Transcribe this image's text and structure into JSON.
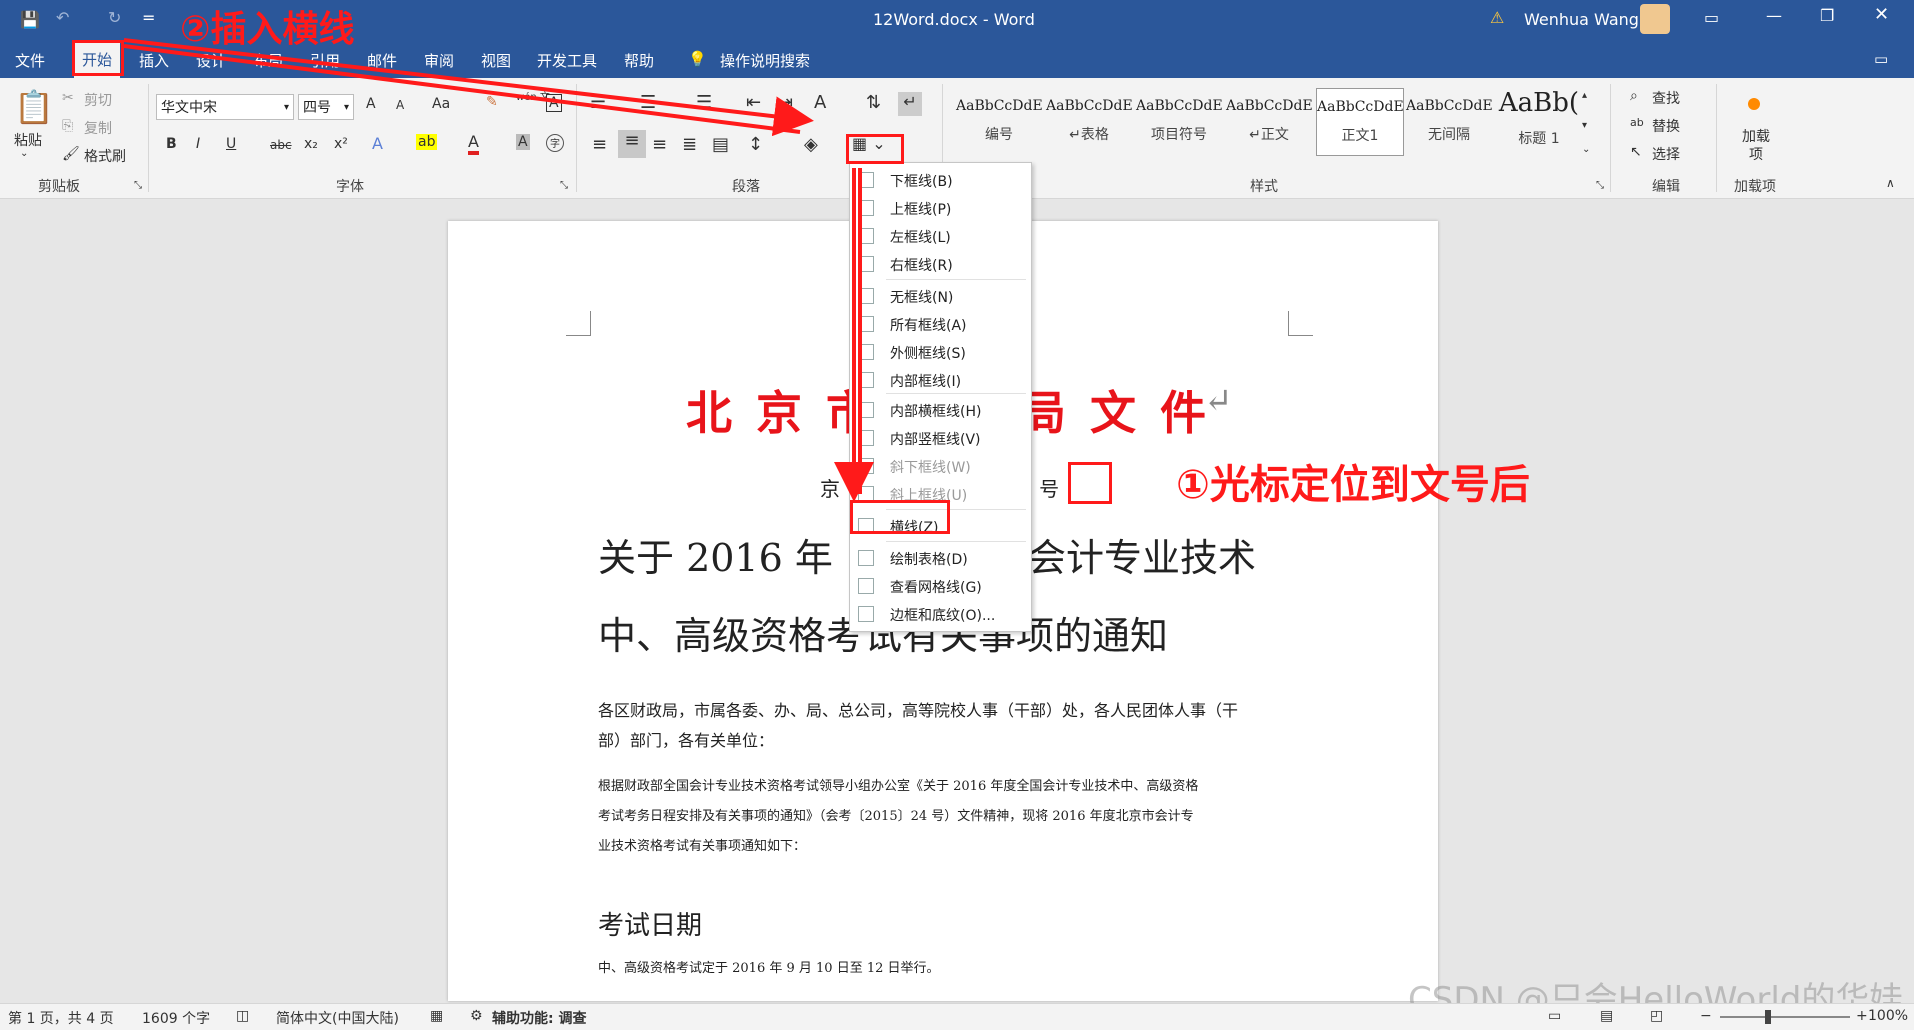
{
  "titlebar": {
    "doc_title": "12Word.docx  -  Word",
    "user_name": "Wenhua Wang",
    "qat_more": "="
  },
  "menu_tabs": [
    "文件",
    "开始",
    "插入",
    "设计",
    "布局",
    "引用",
    "邮件",
    "审阅",
    "视图",
    "开发工具",
    "帮助"
  ],
  "tell_me": "操作说明搜索",
  "clipboard": {
    "paste": "粘贴",
    "cut": "剪切",
    "copy": "复制",
    "format_painter": "格式刷",
    "group": "剪贴板"
  },
  "font": {
    "name": "华文中宋",
    "size": "四号",
    "change_case": "Aa",
    "group": "字体",
    "grow": "A",
    "shrink": "A",
    "bold": "B",
    "italic": "I",
    "underline": "U",
    "strike": "abc",
    "sub": "x₂",
    "sup": "x²",
    "font_color": "A",
    "phonetic": "wén 文",
    "border_char": "A",
    "clear": "A"
  },
  "paragraph": {
    "group": "段落"
  },
  "styles": {
    "group": "样式",
    "items": [
      {
        "preview": "AaBbCcDdE",
        "name": "编号"
      },
      {
        "preview": "AaBbCcDdE",
        "name": "↵表格"
      },
      {
        "preview": "AaBbCcDdE",
        "name": "项目符号"
      },
      {
        "preview": "AaBbCcDdE",
        "name": "↵正文"
      },
      {
        "preview": "AaBbCcDdE",
        "name": "正文1"
      },
      {
        "preview": "AaBbCcDdE",
        "name": "无间隔"
      },
      {
        "preview": "AaBb(",
        "name": "标题 1"
      }
    ]
  },
  "editing": {
    "find": "查找",
    "replace": "替换",
    "select": "选择",
    "group": "编辑"
  },
  "addins": {
    "label": "加载项",
    "sub": "加载项"
  },
  "dropdown": [
    {
      "label": "下框线(B)",
      "disabled": false
    },
    {
      "label": "上框线(P)",
      "disabled": false
    },
    {
      "label": "左框线(L)",
      "disabled": false
    },
    {
      "label": "右框线(R)",
      "disabled": false
    },
    {
      "label": "无框线(N)",
      "disabled": false
    },
    {
      "label": "所有框线(A)",
      "disabled": false
    },
    {
      "label": "外侧框线(S)",
      "disabled": false
    },
    {
      "label": "内部框线(I)",
      "disabled": false
    },
    {
      "label": "内部横框线(H)",
      "disabled": false
    },
    {
      "label": "内部竖框线(V)",
      "disabled": false
    },
    {
      "label": "斜下框线(W)",
      "disabled": true
    },
    {
      "label": "斜上框线(U)",
      "disabled": true
    },
    {
      "label": "横线(Z)",
      "disabled": false
    },
    {
      "label": "绘制表格(D)",
      "disabled": false
    },
    {
      "label": "查看网格线(G)",
      "disabled": false
    },
    {
      "label": "边框和底纹(O)...",
      "disabled": false
    }
  ],
  "document": {
    "header_left": "北 京 市",
    "header_right": "局 文 件",
    "docno_left": "京",
    "docno_right": "3 号",
    "title_line1_left": "关于 2016 年",
    "title_line1_right": "会计专业技术",
    "title_line2": "中、高级资格考试有关事项的通知",
    "addressee_1": "各区财政局，市属各委、办、局、总公司，高等院校人事（干部）处，各人民团体人事（干",
    "addressee_2": "部）部门，各有关单位：",
    "body_1": "根据财政部全国会计专业技术资格考试领导小组办公室《关于 2016 年度全国会计专业技术中、高级资格",
    "body_2": "考试考务日程安排及有关事项的通知》（会考〔2015〕24 号）文件精神，现将 2016 年度北京市会计专",
    "body_3": "业技术资格考试有关事项通知如下：",
    "heading_exam": "考试日期",
    "exam_text": "中、高级资格考试定于 2016 年 9 月 10 日至 12 日举行。"
  },
  "status": {
    "page": "第 1 页，共 4 页",
    "words": "1609 个字",
    "lang": "简体中文(中国大陆)",
    "accessibility": "辅助功能: 调查",
    "zoom": "100%"
  },
  "annotations": {
    "step2": "②插入横线",
    "step1": "①光标定位到文号后",
    "watermark": "CSDN @只会HelloWorld的华娃"
  },
  "colors": {
    "titlebar": "#2b579a",
    "accent_red": "#ff1a1a"
  }
}
